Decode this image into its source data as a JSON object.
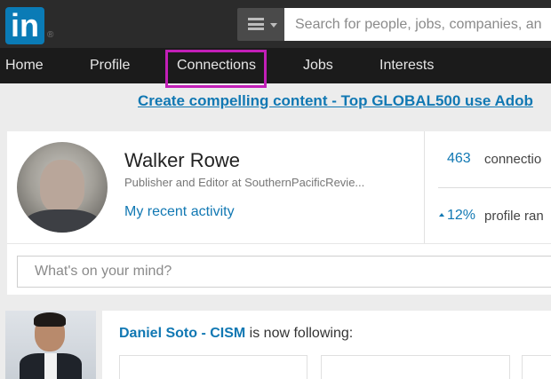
{
  "header": {
    "logo_text": "in",
    "logo_mark": "®",
    "menu_icon": "hamburger-menu-icon",
    "search_placeholder": "Search for people, jobs, companies, an"
  },
  "nav": {
    "items": [
      {
        "label": "Home"
      },
      {
        "label": "Profile"
      },
      {
        "label": "Connections",
        "highlighted": true
      },
      {
        "label": "Jobs"
      },
      {
        "label": "Interests"
      }
    ],
    "highlight_color": "#c21fb7"
  },
  "ad": {
    "text": "Create compelling content - Top GLOBAL500 use Adob"
  },
  "profile": {
    "name": "Walker Rowe",
    "headline": "Publisher and Editor at SouthernPacificRevie...",
    "activity_link": "My recent activity",
    "connections_count": "463",
    "connections_label": "connectio",
    "rank_change": "12%",
    "rank_label": "profile ran"
  },
  "composer": {
    "placeholder": "What's on your mind?"
  },
  "feed": {
    "actor": "Daniel Soto - CISM",
    "action": " is now following:"
  },
  "colors": {
    "link": "#1178b3",
    "topbar": "#2b2b2b",
    "navbar": "#1b1b1b",
    "logo_bg": "#0a7bb6"
  }
}
